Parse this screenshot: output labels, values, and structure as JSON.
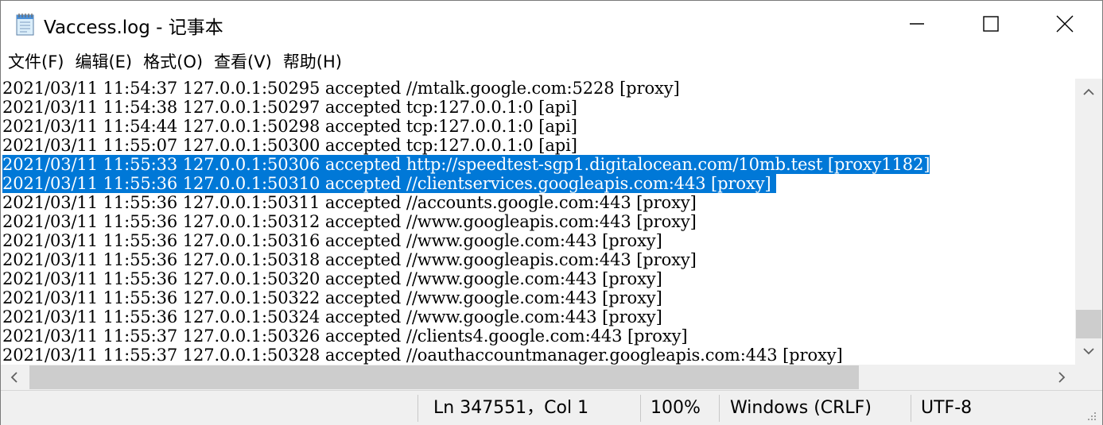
{
  "window": {
    "title": "Vaccess.log - 记事本",
    "icons": {
      "app": "notepad-icon",
      "minimize": "minimize-icon",
      "maximize": "maximize-icon",
      "close": "close-icon"
    }
  },
  "menu": [
    {
      "label": "文件(F)"
    },
    {
      "label": "编辑(E)"
    },
    {
      "label": "格式(O)"
    },
    {
      "label": "查看(V)"
    },
    {
      "label": "帮助(H)"
    }
  ],
  "editor": {
    "selection_color": "#0078d7",
    "lines": [
      {
        "text": "2021/03/11 11:54:37 127.0.0.1:50295 accepted //mtalk.google.com:5228 [proxy]",
        "selected": false
      },
      {
        "text": "2021/03/11 11:54:38 127.0.0.1:50297 accepted tcp:127.0.0.1:0 [api]",
        "selected": false
      },
      {
        "text": "2021/03/11 11:54:44 127.0.0.1:50298 accepted tcp:127.0.0.1:0 [api]",
        "selected": false
      },
      {
        "text": "2021/03/11 11:55:07 127.0.0.1:50300 accepted tcp:127.0.0.1:0 [api]",
        "selected": false
      },
      {
        "text": "2021/03/11 11:55:33 127.0.0.1:50306 accepted http://speedtest-sgp1.digitalocean.com/10mb.test [proxy1182]",
        "selected": true
      },
      {
        "text": "2021/03/11 11:55:36 127.0.0.1:50310 accepted //clientservices.googleapis.com:443 [proxy] ",
        "selected": true
      },
      {
        "text": "2021/03/11 11:55:36 127.0.0.1:50311 accepted //accounts.google.com:443 [proxy]",
        "selected": false
      },
      {
        "text": "2021/03/11 11:55:36 127.0.0.1:50312 accepted //www.googleapis.com:443 [proxy]",
        "selected": false
      },
      {
        "text": "2021/03/11 11:55:36 127.0.0.1:50316 accepted //www.google.com:443 [proxy]",
        "selected": false
      },
      {
        "text": "2021/03/11 11:55:36 127.0.0.1:50318 accepted //www.googleapis.com:443 [proxy]",
        "selected": false
      },
      {
        "text": "2021/03/11 11:55:36 127.0.0.1:50320 accepted //www.google.com:443 [proxy]",
        "selected": false
      },
      {
        "text": "2021/03/11 11:55:36 127.0.0.1:50322 accepted //www.google.com:443 [proxy]",
        "selected": false
      },
      {
        "text": "2021/03/11 11:55:36 127.0.0.1:50324 accepted //www.google.com:443 [proxy]",
        "selected": false
      },
      {
        "text": "2021/03/11 11:55:37 127.0.0.1:50326 accepted //clients4.google.com:443 [proxy]",
        "selected": false
      },
      {
        "text": "2021/03/11 11:55:37 127.0.0.1:50328 accepted //oauthaccountmanager.googleapis.com:443 [proxy]",
        "selected": false
      }
    ]
  },
  "scrollbars": {
    "icons": {
      "up": "chevron-up-icon",
      "down": "chevron-down-icon",
      "left": "chevron-left-icon",
      "right": "chevron-right-icon"
    }
  },
  "status": {
    "position": "Ln 347551，Col 1",
    "zoom": "100%",
    "line_ending": "Windows (CRLF)",
    "encoding": "UTF-8"
  }
}
